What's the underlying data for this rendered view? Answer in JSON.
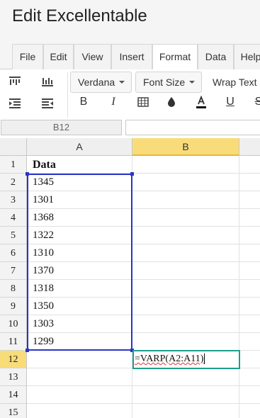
{
  "app": {
    "title": "Edit Excellentable"
  },
  "menu": {
    "tabs": [
      {
        "label": "File"
      },
      {
        "label": "Edit"
      },
      {
        "label": "View"
      },
      {
        "label": "Insert"
      },
      {
        "label": "Format"
      },
      {
        "label": "Data"
      },
      {
        "label": "Help"
      }
    ],
    "active": "Format"
  },
  "toolbar": {
    "font_family": "Verdana",
    "font_size": "Font Size",
    "wrap_text": "Wrap Text",
    "bold": "B",
    "italic": "I",
    "underline": "U",
    "strike": "S"
  },
  "formula_bar": {
    "cell_ref": "B12",
    "value": ""
  },
  "grid": {
    "columns": [
      "A",
      "B"
    ],
    "rows": [
      "1",
      "2",
      "3",
      "4",
      "5",
      "6",
      "7",
      "8",
      "9",
      "10",
      "11",
      "12",
      "13",
      "14",
      "15"
    ],
    "header_cell": "Data",
    "values": [
      "1345",
      "1301",
      "1368",
      "1322",
      "1310",
      "1370",
      "1318",
      "1350",
      "1303",
      "1299"
    ],
    "editing_formula": "=VARP(A2:A11)",
    "selected_column": "B",
    "selected_row": "12"
  },
  "colors": {
    "range_border": "#2a35c8",
    "edit_border": "#1e9e8c",
    "header_highlight": "#f9dc7a"
  }
}
